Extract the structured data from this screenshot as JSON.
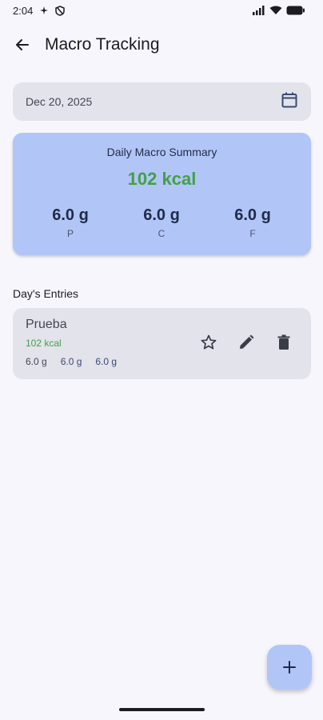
{
  "status_bar": {
    "time": "2:04"
  },
  "app_bar": {
    "title": "Macro Tracking"
  },
  "date_field": {
    "value": "Dec 20, 2025"
  },
  "summary": {
    "title": "Daily Macro Summary",
    "kcal": "102 kcal",
    "protein": {
      "value": "6.0 g",
      "label": "P"
    },
    "carbs": {
      "value": "6.0 g",
      "label": "C"
    },
    "fat": {
      "value": "6.0 g",
      "label": "F"
    }
  },
  "entries_section": {
    "title": "Day's Entries"
  },
  "entries": [
    {
      "name": "Prueba",
      "kcal": "102 kcal",
      "protein": "6.0 g",
      "carbs": "6.0 g",
      "fat": "6.0 g"
    }
  ],
  "colors": {
    "accent": "#b2c5f7",
    "kcal_green": "#43a047",
    "surface": "#e3e3ec",
    "background": "#f7f6fd"
  }
}
